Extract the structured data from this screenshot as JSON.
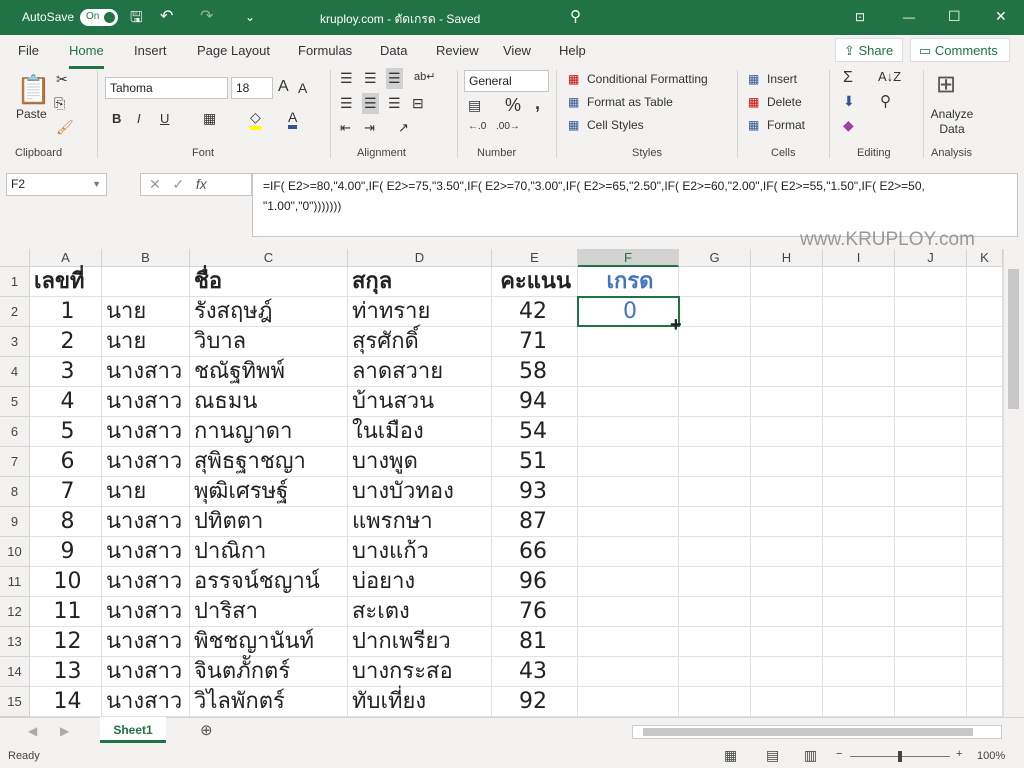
{
  "titlebar": {
    "autosave": "AutoSave",
    "toggle": "On",
    "title": "kruploy.com - ตัดเกรด - Saved"
  },
  "tabs": [
    "File",
    "Home",
    "Insert",
    "Page Layout",
    "Formulas",
    "Data",
    "Review",
    "View",
    "Help"
  ],
  "share": "Share",
  "comments": "Comments",
  "ribbon": {
    "paste": "Paste",
    "font": "Tahoma",
    "size": "18",
    "number_format": "General",
    "conditional": "Conditional Formatting",
    "format_table": "Format as Table",
    "cell_styles": "Cell Styles",
    "insert": "Insert",
    "delete": "Delete",
    "format": "Format",
    "analyze": "Analyze Data",
    "groups": [
      "Clipboard",
      "Font",
      "Alignment",
      "Number",
      "Styles",
      "Cells",
      "Editing",
      "Analysis"
    ]
  },
  "namebox": "F2",
  "formula": "=IF( E2>=80,\"4.00\",IF( E2>=75,\"3.50\",IF( E2>=70,\"3.00\",IF( E2>=65,\"2.50\",IF( E2>=60,\"2.00\",IF( E2>=55,\"1.50\",IF( E2>=50,\n\"1.00\",\"0\")))))))",
  "watermark": "www.KRUPLOY.com",
  "columns": [
    "A",
    "B",
    "C",
    "D",
    "E",
    "F",
    "G",
    "H",
    "I",
    "J",
    "K"
  ],
  "header_row": [
    "เลขที่",
    "",
    "ชื่อ",
    "สกุล",
    "คะแนน",
    "เกรด"
  ],
  "rows": [
    [
      "1",
      "นาย",
      "รังสฤษฎ์",
      "ท่าทราย",
      "42",
      "0"
    ],
    [
      "2",
      "นาย",
      "วิบาล",
      "สุรศักดิ์",
      "71",
      ""
    ],
    [
      "3",
      "นางสาว",
      "ชณัฐทิพพ์",
      "ลาดสวาย",
      "58",
      ""
    ],
    [
      "4",
      "นางสาว",
      "ณธมน",
      "บ้านสวน",
      "94",
      ""
    ],
    [
      "5",
      "นางสาว",
      "กานญาดา",
      "ในเมือง",
      "54",
      ""
    ],
    [
      "6",
      "นางสาว",
      "สุพิธฐาชญา",
      "บางพูด",
      "51",
      ""
    ],
    [
      "7",
      "นาย",
      "พุฒิเศรษฐ์",
      "บางบัวทอง",
      "93",
      ""
    ],
    [
      "8",
      "นางสาว",
      "ปทิตตา",
      "แพรกษา",
      "87",
      ""
    ],
    [
      "9",
      "นางสาว",
      "ปาณิกา",
      "บางแก้ว",
      "66",
      ""
    ],
    [
      "10",
      "นางสาว",
      "อรรจน์ชญาน์",
      "บ่อยาง",
      "96",
      ""
    ],
    [
      "11",
      "นางสาว",
      "ปาริสา",
      "สะเตง",
      "76",
      ""
    ],
    [
      "12",
      "นางสาว",
      "พิชชญานันท์",
      "ปากเพรียว",
      "81",
      ""
    ],
    [
      "13",
      "นางสาว",
      "จินตภัักตร์",
      "บางกระสอ",
      "43",
      ""
    ],
    [
      "14",
      "นางสาว",
      "วิไลพักตร์",
      "ทับเที่ยง",
      "92",
      ""
    ]
  ],
  "sheet": "Sheet1",
  "status": "Ready",
  "zoom": "100%",
  "colors": {
    "accent": "#217346",
    "grade": "#4472c4"
  }
}
